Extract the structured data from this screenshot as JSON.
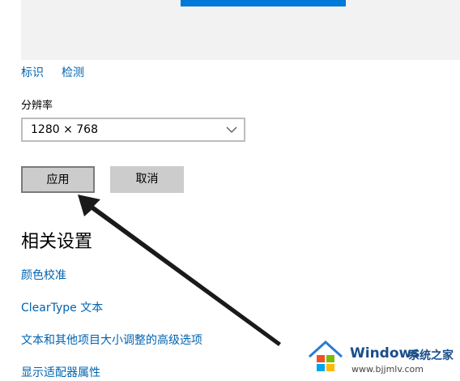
{
  "top_links": {
    "identify": "标识",
    "detect": "检测"
  },
  "resolution": {
    "label": "分辨率",
    "value": "1280 × 768"
  },
  "buttons": {
    "apply": "应用",
    "cancel": "取消"
  },
  "related": {
    "title": "相关设置",
    "links": [
      "颜色校准",
      "ClearType 文本",
      "文本和其他项目大小调整的高级选项",
      "显示适配器属性"
    ]
  },
  "watermark": {
    "brand": "Windows",
    "brand_cn": "系统之家",
    "url": "www.bjjmlv.com"
  },
  "colors": {
    "accent": "#0078d7",
    "link": "#0063b1",
    "button": "#cccccc",
    "preview_bg": "#f2f2f2"
  },
  "icons": [
    "chevron-down-icon",
    "arrow-annotation",
    "windows-logo-icon"
  ]
}
